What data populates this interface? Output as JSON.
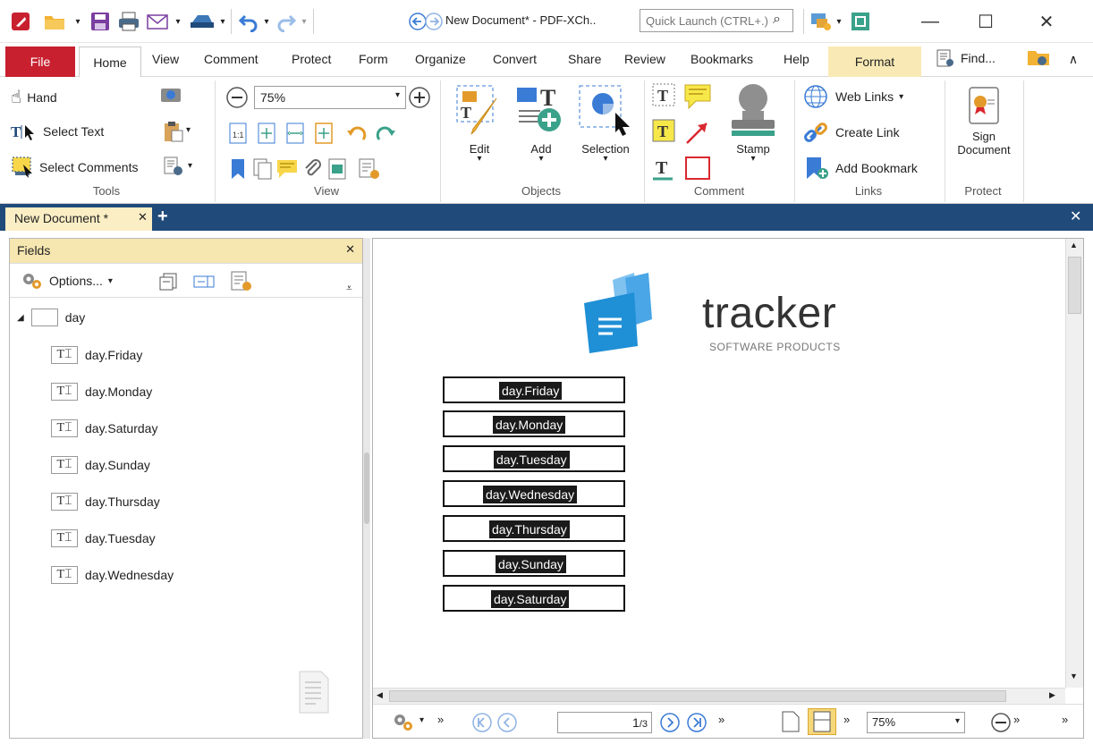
{
  "window": {
    "title": "New Document* - PDF-XCh..",
    "quick_launch_placeholder": "Quick Launch (CTRL+.)"
  },
  "menu": {
    "file": "File",
    "tabs": [
      "Home",
      "View",
      "Comment",
      "Protect",
      "Form",
      "Organize",
      "Convert",
      "Share",
      "Review",
      "Bookmarks",
      "Help"
    ],
    "format": "Format",
    "find": "Find..."
  },
  "ribbon": {
    "tools": {
      "hand": "Hand",
      "select_text": "Select Text",
      "select_comments": "Select Comments",
      "label": "Tools"
    },
    "view": {
      "zoom": "75%",
      "label": "View"
    },
    "objects": {
      "edit": "Edit",
      "add": "Add",
      "selection": "Selection",
      "label": "Objects"
    },
    "comment": {
      "stamp": "Stamp",
      "label": "Comment"
    },
    "links": {
      "web_links": "Web Links",
      "create_link": "Create Link",
      "add_bookmark": "Add Bookmark",
      "label": "Links"
    },
    "protect": {
      "sign_line1": "Sign",
      "sign_line2": "Document",
      "label": "Protect"
    }
  },
  "doc_tab": {
    "title": "New Document *"
  },
  "fields_pane": {
    "title": "Fields",
    "options": "Options...",
    "root": "day",
    "items": [
      "day.Friday",
      "day.Monday",
      "day.Saturday",
      "day.Sunday",
      "day.Thursday",
      "day.Tuesday",
      "day.Wednesday"
    ]
  },
  "document": {
    "logo_word": "tracker",
    "logo_sub": "SOFTWARE PRODUCTS",
    "fields": [
      "day.Friday",
      "day.Monday",
      "day.Tuesday",
      "day.Wednesday",
      "day.Thursday",
      "day.Sunday",
      "day.Saturday"
    ]
  },
  "statusbar": {
    "page": "1",
    "page_total": "/3",
    "zoom": "75%"
  },
  "colors": {
    "file_tab": "#c8202f",
    "format_tab": "#f9eab5",
    "doc_tab_bar": "#1f4a7a",
    "logo_blue": "#1f8fd6"
  }
}
